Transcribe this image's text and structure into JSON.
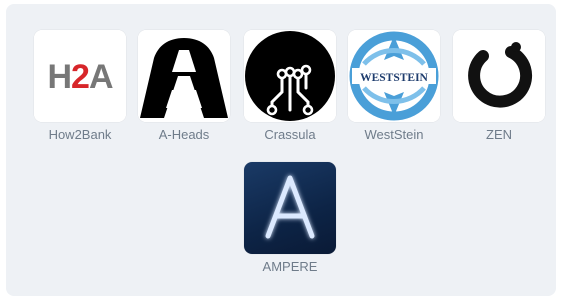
{
  "apps": [
    {
      "label": "How2Bank",
      "logo_text": "H2A",
      "icon": "h2a-logo-icon",
      "colors": {
        "gray": "#777777",
        "red": "#d7262a"
      }
    },
    {
      "label": "A-Heads",
      "icon": "a-heads-helmet-icon",
      "colors": {
        "black": "#000000"
      }
    },
    {
      "label": "Crassula",
      "icon": "crassula-circuit-icon",
      "colors": {
        "black": "#000000"
      }
    },
    {
      "label": "WestStein",
      "logo_text": "WESTSTEIN",
      "icon": "weststein-globe-icon",
      "colors": {
        "blue": "#4a9fd8",
        "text": "#1f3d6e"
      }
    },
    {
      "label": "ZEN",
      "icon": "zen-ring-icon",
      "colors": {
        "black": "#111111"
      }
    },
    {
      "label": "AMPERE",
      "logo_text": "A",
      "icon": "ampere-glow-icon",
      "colors": {
        "background": "#0f2a50",
        "glow": "#dbe9ff"
      }
    }
  ]
}
